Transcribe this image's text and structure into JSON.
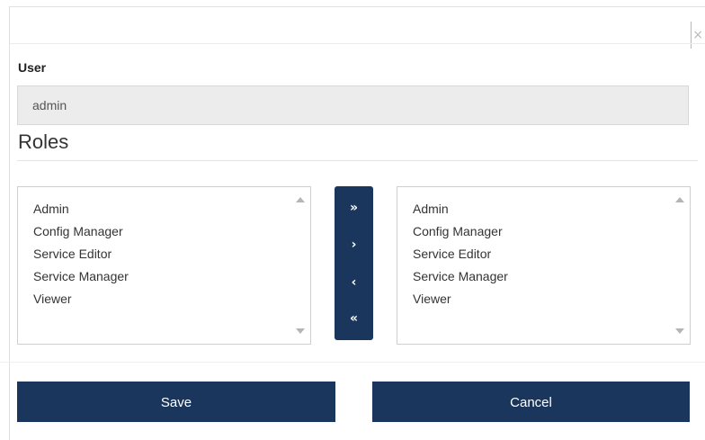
{
  "dialog": {
    "close_glyph": "×"
  },
  "user": {
    "label": "User",
    "value": "admin"
  },
  "roles": {
    "heading": "Roles",
    "available": [
      "Admin",
      "Config Manager",
      "Service Editor",
      "Service Manager",
      "Viewer"
    ],
    "selected": [
      "Admin",
      "Config Manager",
      "Service Editor",
      "Service Manager",
      "Viewer"
    ]
  },
  "transfer": {
    "move_all_right": "»",
    "move_right": "›",
    "move_left": "‹",
    "move_all_left": "«"
  },
  "actions": {
    "save_label": "Save",
    "cancel_label": "Cancel"
  },
  "colors": {
    "primary": "#1b365d",
    "field_bg": "#ececec"
  }
}
